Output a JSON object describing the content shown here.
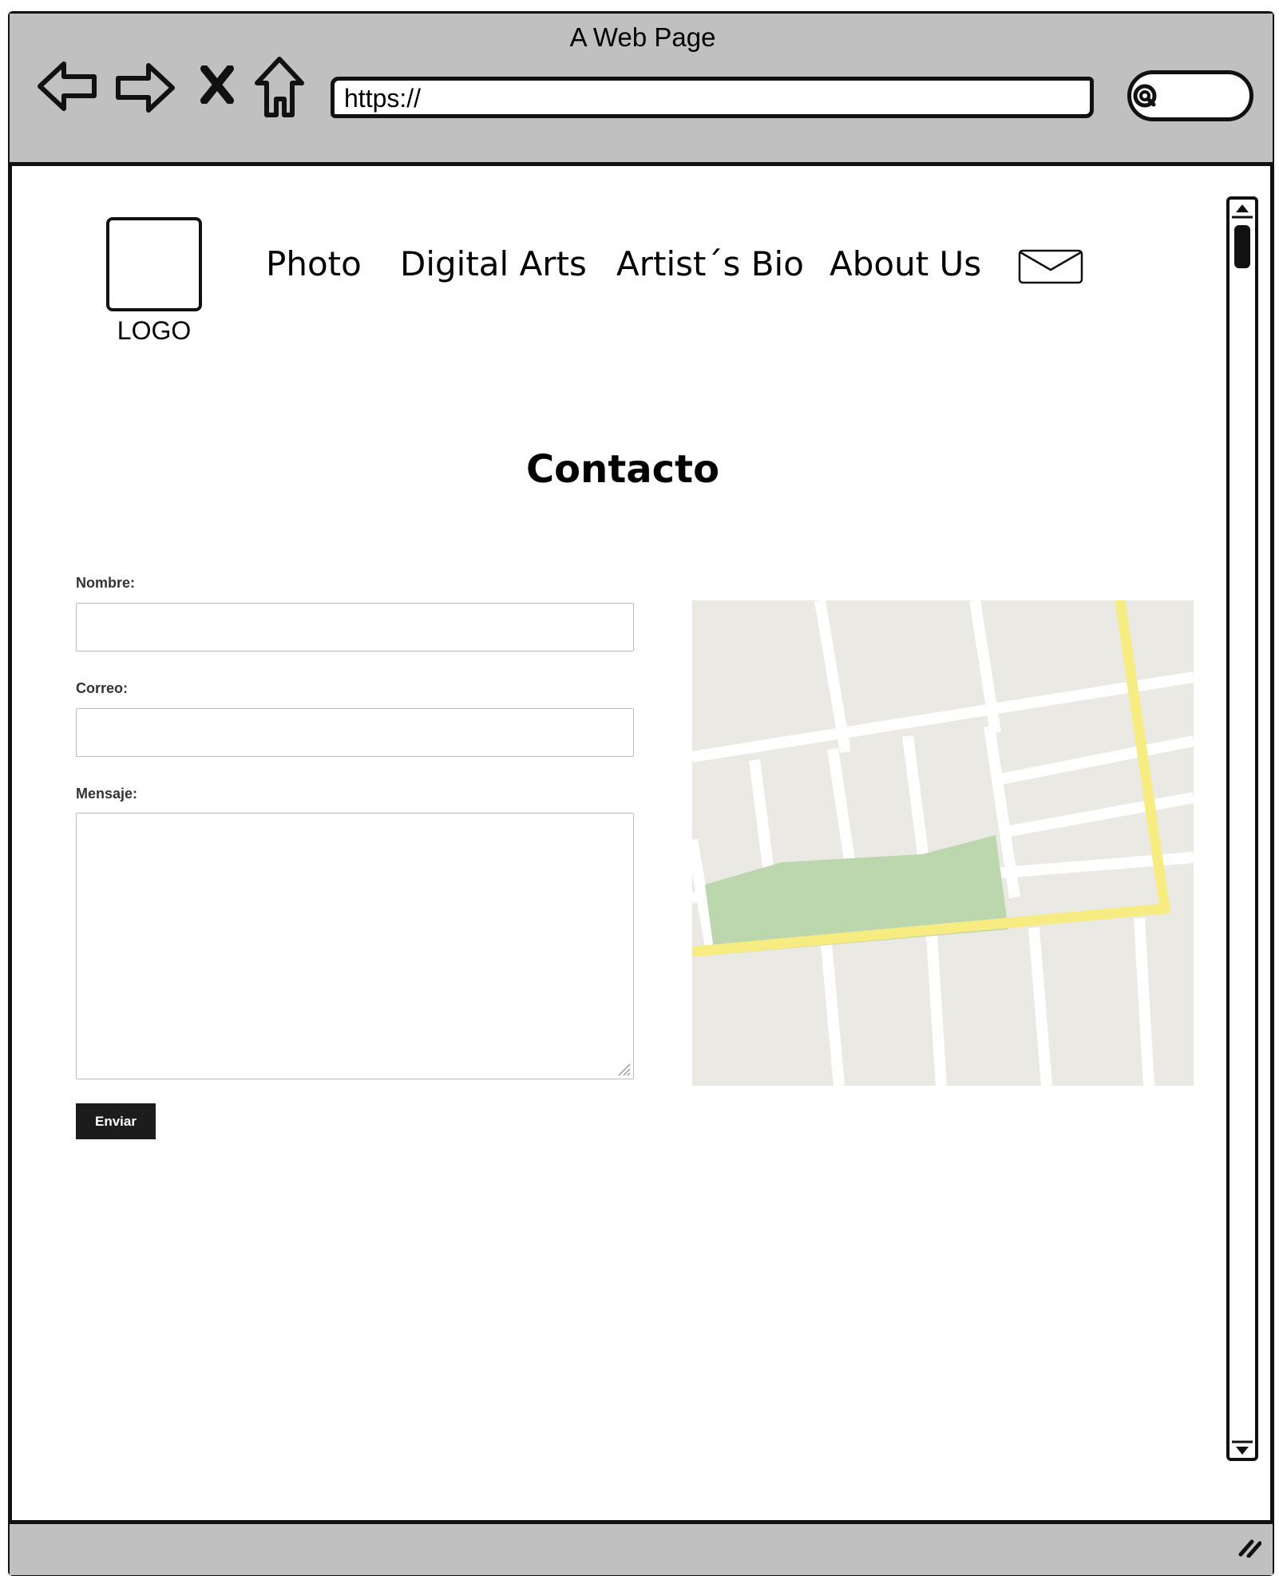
{
  "window": {
    "title": "A Web Page"
  },
  "browser": {
    "url": "https://",
    "icons": [
      "back-arrow-icon",
      "forward-arrow-icon",
      "stop-icon",
      "home-icon",
      "search-icon"
    ]
  },
  "site": {
    "logo_label": "LOGO",
    "nav": [
      {
        "label": "Photo"
      },
      {
        "label": "Digital Arts"
      },
      {
        "label": "Artist´s Bio"
      },
      {
        "label": "About Us"
      }
    ],
    "mail_icon": "envelope-icon"
  },
  "contact": {
    "heading": "Contacto",
    "name_label": "Nombre:",
    "email_label": "Correo:",
    "message_label": "Mensaje:",
    "name_value": "",
    "email_value": "",
    "message_value": "",
    "submit_label": "Enviar"
  },
  "colors": {
    "chrome_gray": "#c0c0c0",
    "map_block": "#ebe9e4",
    "map_park": "#bcd6ad",
    "map_major_road": "#f6ec81"
  }
}
